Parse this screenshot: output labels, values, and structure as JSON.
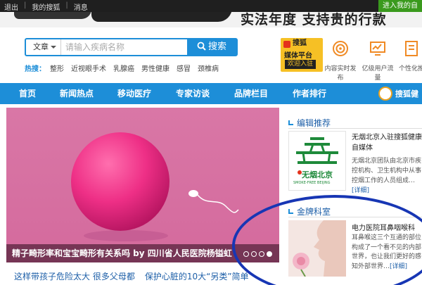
{
  "topbar": {
    "logout": "退出",
    "my_sohu": "我的搜狐",
    "messages": "消息",
    "enter_button": "进入我的自"
  },
  "banner": {
    "slogan": "实法年度 支持贵的行款"
  },
  "search": {
    "category": "文章",
    "placeholder": "请输入疾病名称",
    "button_label": "搜索",
    "hot_label": "热搜：",
    "hot_keywords": [
      "整形",
      "近视眼手术",
      "乳腺癌",
      "男性健康",
      "感冒",
      "颈椎病"
    ]
  },
  "media_platform": {
    "line1": "搜狐",
    "line2": "媒体平台",
    "join": "欢迎入驻"
  },
  "features": [
    "内容实时发布",
    "亿级用户流量",
    "个性化推"
  ],
  "nav": {
    "items": [
      "首页",
      "新闻热点",
      "移动医疗",
      "专家访谈",
      "品牌栏目",
      "作者排行"
    ],
    "brand": "搜狐健"
  },
  "slider": {
    "caption": "精子畸形率和宝宝畸形有关系吗 by 四川省人民医院杨镒虹"
  },
  "sub_links": [
    "这样带孩子危险太大 很多父母都",
    "保护心脏的10大“另类”简单"
  ],
  "editor_pick": {
    "heading": "编辑推荐",
    "title": "无烟北京入驻搜狐健康自媒体",
    "description": "无烟北京团队由北京市疾控机构、卫生机构中从事控烟工作的人员组成…",
    "more": "[详细]",
    "logo_text": "无烟北京",
    "logo_subtext": "SMOKE-FREE BEIJING"
  },
  "gold_department": {
    "heading": "金牌科室",
    "title": "电力医院耳鼻咽喉科",
    "description": "耳鼻喉这三个互通的部位构成了一个看不见的内部世界，也让我们更好的感知外部世界…",
    "more": "[详细]"
  },
  "colors": {
    "accent": "#1d8ed8",
    "topbar": "#1f1f1f",
    "enter_button": "#3a9a1d",
    "annotation": "#1736b4"
  }
}
